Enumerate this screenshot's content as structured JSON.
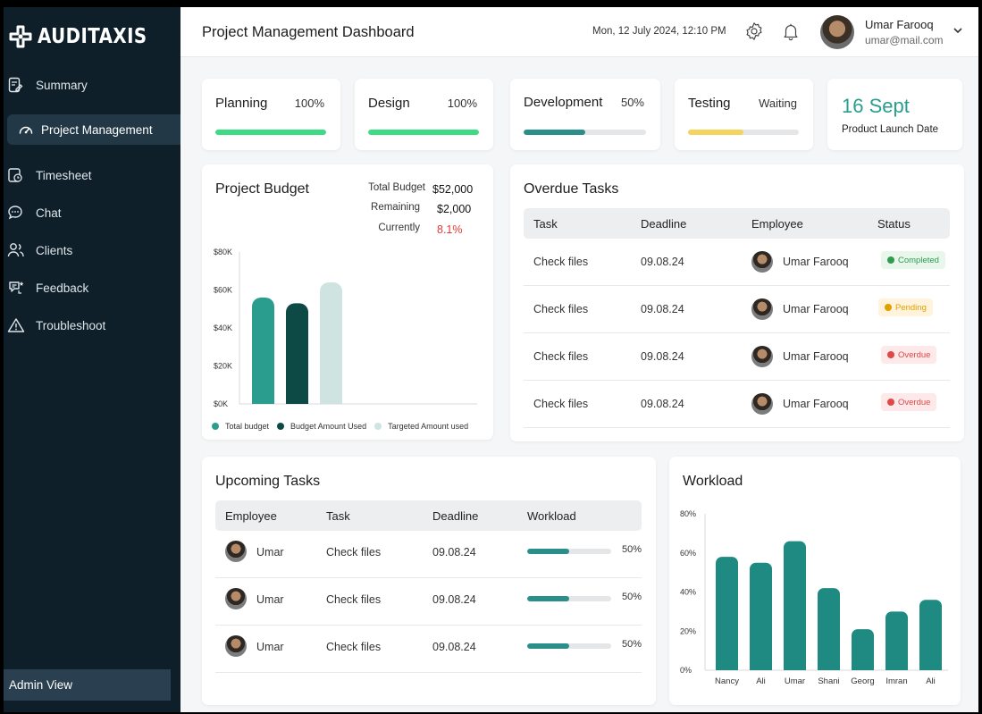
{
  "app": {
    "brand": "AUDITAXIS"
  },
  "sidebar": {
    "items": [
      {
        "label": "Summary",
        "icon": "document-edit-icon"
      },
      {
        "label": "Project Management",
        "icon": "speedometer-icon",
        "active": true
      },
      {
        "label": "Timesheet",
        "icon": "timesheet-icon"
      },
      {
        "label": "Chat",
        "icon": "chat-bubble-icon"
      },
      {
        "label": "Clients",
        "icon": "users-icon"
      },
      {
        "label": "Feedback",
        "icon": "feedback-icon"
      },
      {
        "label": "Troubleshoot",
        "icon": "warning-icon"
      }
    ],
    "admin_label": "Admin View"
  },
  "header": {
    "title": "Project Management Dashboard",
    "datetime": "Mon, 12 July 2024,  12:10 PM",
    "user_name": "Umar Farooq",
    "user_email": "umar@mail.com"
  },
  "phases": [
    {
      "name": "Planning",
      "value": "100%",
      "progress": 1.0,
      "color": "#3ddc84"
    },
    {
      "name": "Design",
      "value": "100%",
      "progress": 1.0,
      "color": "#3ddc84"
    },
    {
      "name": "Development",
      "value": "50%",
      "progress": 0.5,
      "color": "#2a8f8a"
    },
    {
      "name": "Testing",
      "value": "Waiting",
      "progress": 0.5,
      "color": "#f4d35e"
    }
  ],
  "launch": {
    "date": "16 Sept",
    "label": "Product Launch Date"
  },
  "budget": {
    "title": "Project Budget",
    "stats": [
      {
        "label": "Total  Budget",
        "value": "$52,000",
        "color": "#111111"
      },
      {
        "label": "Remaining",
        "value": "$2,000",
        "color": "#111111"
      },
      {
        "label": "Currently",
        "value": "8.1%",
        "color": "#e53935"
      }
    ],
    "legend": [
      {
        "label": "Total budget",
        "color": "#2a9d8f"
      },
      {
        "label": "Budget Amount Used",
        "color": "#0d4a45"
      },
      {
        "label": "Targeted Amount used",
        "color": "#cfe3e1"
      }
    ]
  },
  "overdue": {
    "title": "Overdue Tasks",
    "headers": [
      "Task",
      "Deadline",
      "Employee",
      "Status"
    ],
    "rows": [
      {
        "task": "Check files",
        "deadline": "09.08.24",
        "employee": "Umar Farooq",
        "status": "Completed",
        "status_color": "#2e9b4f",
        "status_bg": "#e8f6ec"
      },
      {
        "task": "Check files",
        "deadline": "09.08.24",
        "employee": "Umar Farooq",
        "status": "Pending",
        "status_color": "#e0a000",
        "status_bg": "#fff3dc"
      },
      {
        "task": "Check files",
        "deadline": "09.08.24",
        "employee": "Umar Farooq",
        "status": "Overdue",
        "status_color": "#e04848",
        "status_bg": "#fde9e9"
      },
      {
        "task": "Check files",
        "deadline": "09.08.24",
        "employee": "Umar Farooq",
        "status": "Overdue",
        "status_color": "#e04848",
        "status_bg": "#fde9e9"
      }
    ]
  },
  "upcoming": {
    "title": "Upcoming Tasks",
    "headers": [
      "Employee",
      "Task",
      "Deadline",
      "Workload"
    ],
    "rows": [
      {
        "employee": "Umar",
        "task": "Check files",
        "deadline": "09.08.24",
        "workload": "50%",
        "progress": 0.5
      },
      {
        "employee": "Umar",
        "task": "Check files",
        "deadline": "09.08.24",
        "workload": "50%",
        "progress": 0.5
      },
      {
        "employee": "Umar",
        "task": "Check files",
        "deadline": "09.08.24",
        "workload": "50%",
        "progress": 0.5
      }
    ]
  },
  "workload": {
    "title": "Workload"
  },
  "chart_data": [
    {
      "type": "bar",
      "title": "Project Budget",
      "categories": [
        "Total budget",
        "Budget Amount Used",
        "Targeted Amount used"
      ],
      "values": [
        56000,
        53000,
        64000
      ],
      "colors": [
        "#2a9d8f",
        "#0d4a45",
        "#cfe3e1"
      ],
      "ylim": [
        0,
        80000
      ],
      "yticks": [
        "$0K",
        "$20K",
        "$40K",
        "$60K",
        "$80K"
      ],
      "legend": "bottom"
    },
    {
      "type": "bar",
      "title": "Workload",
      "categories": [
        "Nancy",
        "Ali",
        "Umar",
        "Shani",
        "Georg",
        "Imran",
        "Ali"
      ],
      "values": [
        58,
        55,
        66,
        42,
        21,
        30,
        36
      ],
      "color": "#1f8a82",
      "ylim": [
        0,
        80
      ],
      "yticks": [
        "0%",
        "20%",
        "40%",
        "60%",
        "80%"
      ]
    }
  ]
}
